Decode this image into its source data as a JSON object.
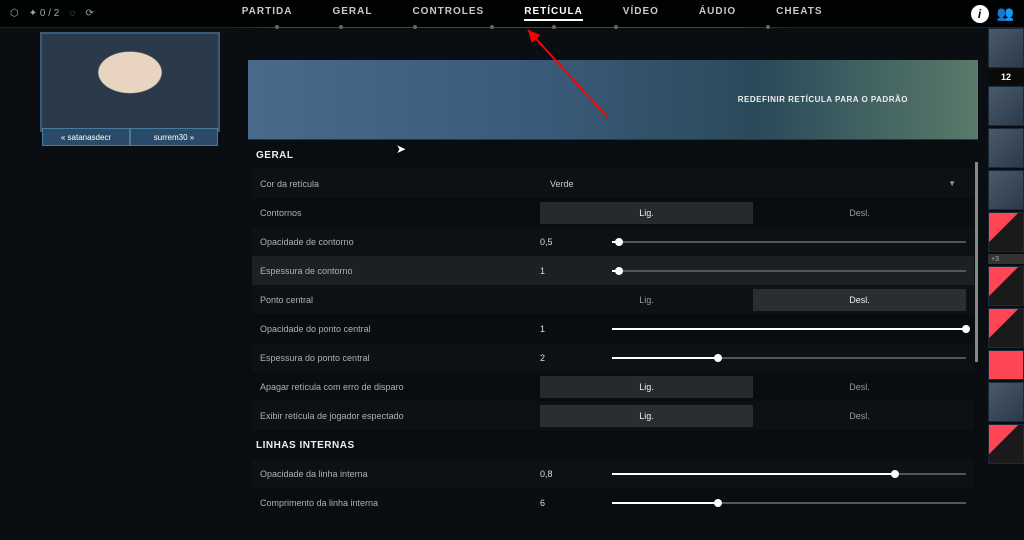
{
  "topbar": {
    "score": "0 / 2",
    "nav": [
      "PARTIDA",
      "GERAL",
      "CONTROLES",
      "RETÍCULA",
      "VÍDEO",
      "ÁUDIO",
      "CHEATS"
    ],
    "active_index": 3
  },
  "webcam": {
    "name_left": "« satanasdecr",
    "name_right": "surrem30 »"
  },
  "panel": {
    "reset_label": "REDEFINIR RETÍCULA PARA O PADRÃO",
    "sections": [
      {
        "title": "GERAL"
      },
      {
        "title": "LINHAS INTERNAS"
      }
    ],
    "dropdown": {
      "label": "Cor da retícula",
      "value": "Verde"
    },
    "toggle_labels": {
      "on": "Lig.",
      "off": "Desl."
    },
    "rows_general": [
      {
        "label": "Contornos",
        "type": "toggle",
        "selected": "on"
      },
      {
        "label": "Opacidade de contorno",
        "type": "slider",
        "value": "0,5",
        "pct": 2
      },
      {
        "label": "Espessura de contorno",
        "type": "slider",
        "value": "1",
        "pct": 2,
        "highlight": true
      },
      {
        "label": "Ponto central",
        "type": "toggle",
        "selected": "off"
      },
      {
        "label": "Opacidade do ponto central",
        "type": "slider",
        "value": "1",
        "pct": 100
      },
      {
        "label": "Espessura do ponto central",
        "type": "slider",
        "value": "2",
        "pct": 30
      },
      {
        "label": "Apagar retícula com erro de disparo",
        "type": "toggle",
        "selected": "on"
      },
      {
        "label": "Exibir retícula de jogador espectado",
        "type": "toggle",
        "selected": "on"
      }
    ],
    "rows_inner": [
      {
        "label": "Opacidade da linha interna",
        "type": "slider",
        "value": "0,8",
        "pct": 80
      },
      {
        "label": "Comprimento da linha interna",
        "type": "slider",
        "value": "6",
        "pct": 30
      }
    ]
  },
  "sidebar": {
    "team_score": "12",
    "badge": "+3"
  }
}
